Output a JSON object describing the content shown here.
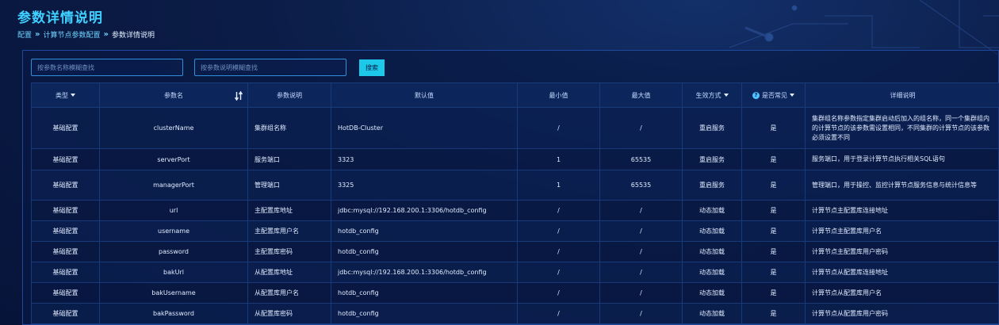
{
  "page": {
    "title": "参数详情说明"
  },
  "breadcrumb": [
    {
      "label": "配置"
    },
    {
      "label": "计算节点参数配置"
    },
    {
      "label": "参数详情说明"
    }
  ],
  "search": {
    "name_placeholder": "按参数名称模糊查找",
    "desc_placeholder": "按参数说明模糊查找",
    "button_label": "搜索"
  },
  "table": {
    "headers": {
      "type": "类型",
      "name": "参数名",
      "explain": "参数说明",
      "default": "默认值",
      "min": "最小值",
      "max": "最大值",
      "effect": "生效方式",
      "common": "是否常见",
      "detail": "详细说明"
    },
    "rows": [
      {
        "type": "基础配置",
        "name": "clusterName",
        "explain": "集群组名称",
        "default": "HotDB-Cluster",
        "min": "/",
        "max": "/",
        "effect": "重启服务",
        "common": "是",
        "detail": "集群组名称参数指定集群启动后加入的组名称，同一个集群组内的计算节点的该参数需设置相同，不同集群的计算节点的该参数必须设置不同"
      },
      {
        "type": "基础配置",
        "name": "serverPort",
        "explain": "服务端口",
        "default": "3323",
        "min": "1",
        "max": "65535",
        "effect": "重启服务",
        "common": "是",
        "detail": "服务端口，用于登录计算节点执行相关SQL语句"
      },
      {
        "type": "基础配置",
        "name": "managerPort",
        "explain": "管理端口",
        "default": "3325",
        "min": "1",
        "max": "65535",
        "effect": "重启服务",
        "common": "是",
        "detail": "管理端口，用于操控、监控计算节点服务信息与统计信息等"
      },
      {
        "type": "基础配置",
        "name": "url",
        "explain": "主配置库地址",
        "default": "jdbc:mysql://192.168.200.1:3306/hotdb_config",
        "min": "/",
        "max": "/",
        "effect": "动态加载",
        "common": "是",
        "detail": "计算节点主配置库连接地址"
      },
      {
        "type": "基础配置",
        "name": "username",
        "explain": "主配置库用户名",
        "default": "hotdb_config",
        "min": "/",
        "max": "/",
        "effect": "动态加载",
        "common": "是",
        "detail": "计算节点主配置库用户名"
      },
      {
        "type": "基础配置",
        "name": "password",
        "explain": "主配置库密码",
        "default": "hotdb_config",
        "min": "/",
        "max": "/",
        "effect": "动态加载",
        "common": "是",
        "detail": "计算节点主配置库用户密码"
      },
      {
        "type": "基础配置",
        "name": "bakUrl",
        "explain": "从配置库地址",
        "default": "jdbc:mysql://192.168.200.1:3306/hotdb_config",
        "min": "/",
        "max": "/",
        "effect": "动态加载",
        "common": "是",
        "detail": "计算节点从配置库连接地址"
      },
      {
        "type": "基础配置",
        "name": "bakUsername",
        "explain": "从配置库用户名",
        "default": "hotdb_config",
        "min": "/",
        "max": "/",
        "effect": "动态加载",
        "common": "是",
        "detail": "计算节点从配置库用户名"
      },
      {
        "type": "基础配置",
        "name": "bakPassword",
        "explain": "从配置库密码",
        "default": "hotdb_config",
        "min": "/",
        "max": "/",
        "effect": "动态加载",
        "common": "是",
        "detail": "计算节点从配置库用户密码"
      }
    ]
  },
  "colors": {
    "accent": "#3fd0ff",
    "button": "#1ec8e8",
    "background": "#0b1c46",
    "border": "#18397a"
  },
  "icons": {
    "sort": "sort-icon",
    "dropdown": "caret-down-icon",
    "help": "question-icon"
  }
}
